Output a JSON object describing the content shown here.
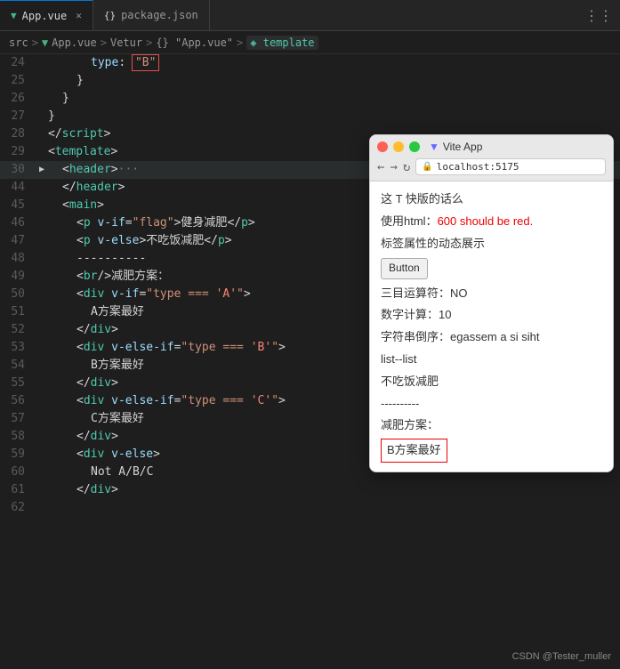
{
  "tabs": [
    {
      "id": "app-vue",
      "label": "App.vue",
      "icon": "vue",
      "active": true
    },
    {
      "id": "package-json",
      "label": "package.json",
      "icon": "json",
      "active": false
    }
  ],
  "tab_bar_right": "⋮⋮",
  "breadcrumb": {
    "src": "src",
    "sep1": ">",
    "vue_icon": "▼",
    "app_vue": "App.vue",
    "sep2": ">",
    "vetur": "Vetur",
    "sep3": ">",
    "obj": "{}  \"App.vue\"",
    "sep4": ">",
    "template_icon": "◈",
    "template": "template"
  },
  "lines": [
    {
      "num": "24",
      "indent": "i3",
      "content_html": "<span class='attr'>type</span><span class='punct'>: </span><span class='str red-box'>\"B\"</span>",
      "arrow": ""
    },
    {
      "num": "25",
      "indent": "i2",
      "content_html": "<span class='punct'>}</span>",
      "arrow": ""
    },
    {
      "num": "26",
      "indent": "i1",
      "content_html": "<span class='punct'>}</span>",
      "arrow": ""
    },
    {
      "num": "27",
      "indent": "",
      "content_html": "<span class='punct'>}</span>",
      "arrow": ""
    },
    {
      "num": "28",
      "indent": "",
      "content_html": "<span class='punct'>&lt;/</span><span class='tag'>script</span><span class='punct'>&gt;</span>",
      "arrow": ""
    },
    {
      "num": "29",
      "indent": "",
      "content_html": "<span class='punct'>&lt;</span><span class='tag'>template</span><span class='punct'>&gt;</span>",
      "arrow": ""
    },
    {
      "num": "30",
      "indent": "i1",
      "content_html": "<span class='punct'>&lt;</span><span class='tag'>header</span><span class='punct'>&gt;</span><span class='comment'>···</span>",
      "arrow": "▶",
      "highlight": true
    },
    {
      "num": "44",
      "indent": "i1",
      "content_html": "<span class='punct'>&lt;/</span><span class='tag'>header</span><span class='punct'>&gt;</span>",
      "arrow": ""
    },
    {
      "num": "45",
      "indent": "i1",
      "content_html": "<span class='punct'>&lt;</span><span class='tag'>main</span><span class='punct'>&gt;</span>",
      "arrow": ""
    },
    {
      "num": "46",
      "indent": "i2",
      "content_html": "<span class='punct'>&lt;</span><span class='tag'>p</span> <span class='attr'>v-if</span><span class='eq'>=</span><span class='str'>\"flag\"</span><span class='punct'>&gt;</span><span class='text'>健身减肥</span><span class='punct'>&lt;/</span><span class='tag'>p</span><span class='punct'>&gt;</span>",
      "arrow": ""
    },
    {
      "num": "47",
      "indent": "i2",
      "content_html": "<span class='punct'>&lt;</span><span class='tag'>p</span> <span class='attr'>v-else</span><span class='punct'>&gt;</span><span class='text'>不吃饭减肥</span><span class='punct'>&lt;/</span><span class='tag'>p</span><span class='punct'>&gt;</span>",
      "arrow": ""
    },
    {
      "num": "48",
      "indent": "i2",
      "content_html": "<span class='text'>----------</span>",
      "arrow": ""
    },
    {
      "num": "49",
      "indent": "i2",
      "content_html": "<span class='punct'>&lt;</span><span class='tag'>br</span><span class='punct'>/&gt;</span><span class='text'>减肥方案：</span>",
      "arrow": ""
    },
    {
      "num": "50",
      "indent": "i2",
      "content_html": "<span class='punct'>&lt;</span><span class='tag'>div</span> <span class='attr'>v-if</span><span class='eq'>=</span><span class='str'>\"type === '</span><span class='str-red'>A</span><span class='str'>'\"</span><span class='punct'>&gt;</span>",
      "arrow": ""
    },
    {
      "num": "51",
      "indent": "i3",
      "content_html": "<span class='text'>A方案最好</span>",
      "arrow": ""
    },
    {
      "num": "52",
      "indent": "i2",
      "content_html": "<span class='punct'>&lt;/</span><span class='tag'>div</span><span class='punct'>&gt;</span>",
      "arrow": ""
    },
    {
      "num": "53",
      "indent": "i2",
      "content_html": "<span class='punct'>&lt;</span><span class='tag'>div</span> <span class='attr'>v-else-if</span><span class='eq'>=</span><span class='str'>\"type === '</span><span class='str-red'>B</span><span class='str'>'\"</span><span class='punct'>&gt;</span>",
      "arrow": ""
    },
    {
      "num": "54",
      "indent": "i3",
      "content_html": "<span class='text'>B方案最好</span>",
      "arrow": ""
    },
    {
      "num": "55",
      "indent": "i2",
      "content_html": "<span class='punct'>&lt;/</span><span class='tag'>div</span><span class='punct'>&gt;</span>",
      "arrow": ""
    },
    {
      "num": "56",
      "indent": "i2",
      "content_html": "<span class='punct'>&lt;</span><span class='tag'>div</span> <span class='attr'>v-else-if</span><span class='eq'>=</span><span class='str'>\"type === '</span><span class='str-red'>C</span><span class='str'>'\"</span><span class='punct'>&gt;</span>",
      "arrow": ""
    },
    {
      "num": "57",
      "indent": "i3",
      "content_html": "<span class='text'>C方案最好</span>",
      "arrow": ""
    },
    {
      "num": "58",
      "indent": "i2",
      "content_html": "<span class='punct'>&lt;/</span><span class='tag'>div</span><span class='punct'>&gt;</span>",
      "arrow": ""
    },
    {
      "num": "59",
      "indent": "i2",
      "content_html": "<span class='punct'>&lt;</span><span class='tag'>div</span> <span class='attr'>v-else</span><span class='punct'>&gt;</span>",
      "arrow": ""
    },
    {
      "num": "60",
      "indent": "i3",
      "content_html": "<span class='text'>Not A/B/C</span>",
      "arrow": ""
    },
    {
      "num": "61",
      "indent": "i2",
      "content_html": "<span class='punct'>&lt;/</span><span class='tag'>div</span><span class='punct'>&gt;</span>",
      "arrow": ""
    },
    {
      "num": "62",
      "indent": "",
      "content_html": "",
      "arrow": ""
    }
  ],
  "browser": {
    "title": "Vite App",
    "address": "localhost:5175",
    "nav_back": "←",
    "nav_forward": "→",
    "nav_refresh": "↻",
    "content_lines": [
      {
        "text": "这 T 快版的话么",
        "class": ""
      },
      {
        "text": "使用html：600 should be red.",
        "class": "html-line"
      },
      {
        "text": "标签属性的动态展示",
        "class": ""
      },
      {
        "text": "Button",
        "class": "button"
      },
      {
        "text": "三目运算符：NO",
        "class": ""
      },
      {
        "text": "数字计算：10",
        "class": ""
      },
      {
        "text": "字符串倒序：egassem a si siht",
        "class": ""
      },
      {
        "text": "list--list",
        "class": ""
      },
      {
        "text": "不吃饭减肥",
        "class": ""
      },
      {
        "text": "----------",
        "class": ""
      },
      {
        "text": "减肥方案：",
        "class": ""
      },
      {
        "text": "B方案最好",
        "class": "result"
      }
    ]
  },
  "watermark": "CSDN @Tester_muller"
}
